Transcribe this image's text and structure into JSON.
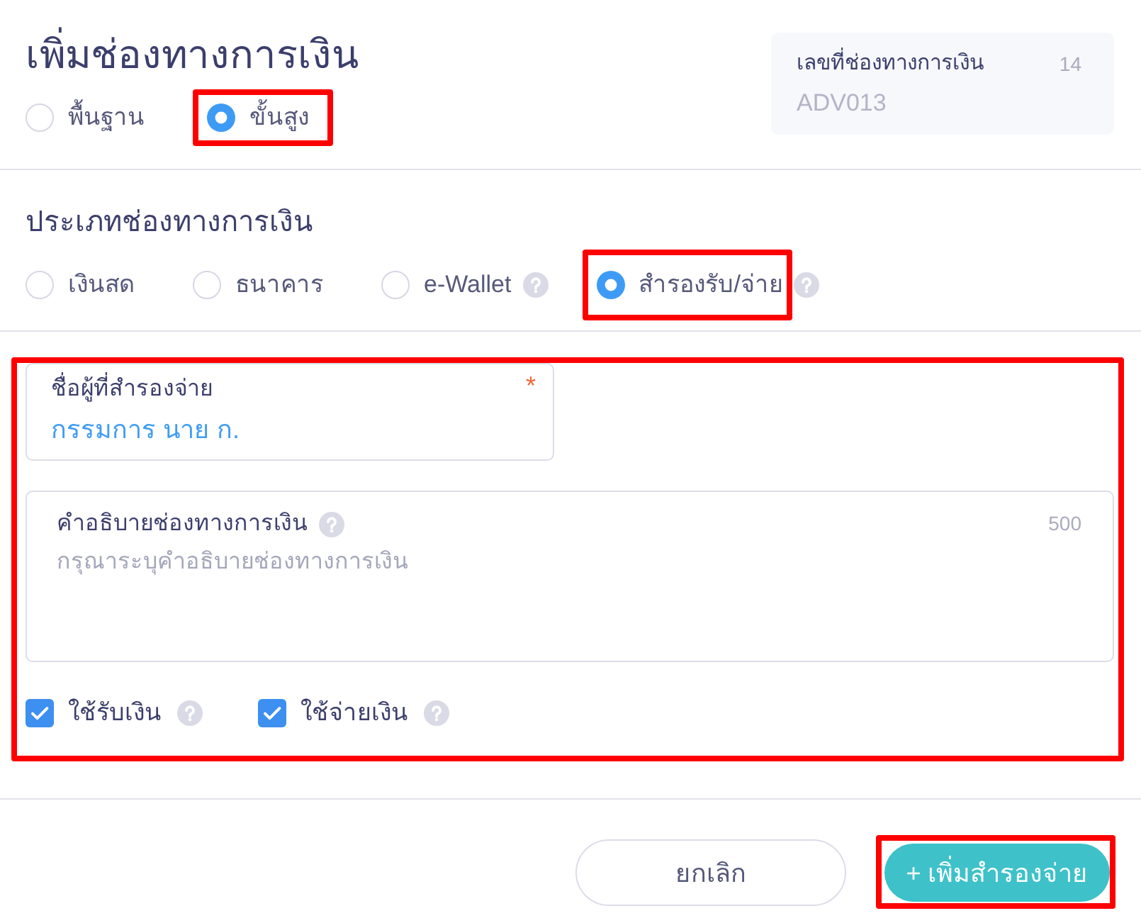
{
  "header": {
    "title": "เพิ่มช่องทางการเงิน",
    "modes": [
      {
        "label": "พื้นฐาน",
        "selected": false,
        "highlighted": false
      },
      {
        "label": "ขั้นสูง",
        "selected": true,
        "highlighted": true
      }
    ]
  },
  "number_card": {
    "label": "เลขที่ช่องทางการเงิน",
    "count": "14",
    "value": "ADV013"
  },
  "channel_type": {
    "heading": "ประเภทช่องทางการเงิน",
    "options": [
      {
        "label": "เงินสด",
        "selected": false,
        "highlighted": false,
        "help": false
      },
      {
        "label": "ธนาคาร",
        "selected": false,
        "highlighted": false,
        "help": false
      },
      {
        "label": "e-Wallet",
        "selected": false,
        "highlighted": false,
        "help": true
      },
      {
        "label": "สำรองรับ/จ่าย",
        "selected": true,
        "highlighted": true,
        "help": true
      }
    ]
  },
  "form": {
    "highlighted": true,
    "payer_field": {
      "label": "ชื่อผู้ที่สำรองจ่าย",
      "required_mark": "*",
      "value": "กรรมการ นาย ก."
    },
    "description_field": {
      "label": "คำอธิบายช่องทางการเงิน",
      "help": true,
      "counter": "500",
      "placeholder": "กรุณาระบุคำอธิบายช่องทางการเงิน"
    },
    "checkboxes": [
      {
        "label": "ใช้รับเงิน",
        "checked": true,
        "help": true
      },
      {
        "label": "ใช้จ่ายเงิน",
        "checked": true,
        "help": true
      }
    ]
  },
  "footer": {
    "buttons": [
      {
        "label": "ยกเลิก",
        "kind": "secondary",
        "highlighted": false
      },
      {
        "label": "+ เพิ่มสำรองจ่าย",
        "kind": "primary",
        "highlighted": true
      }
    ]
  }
}
